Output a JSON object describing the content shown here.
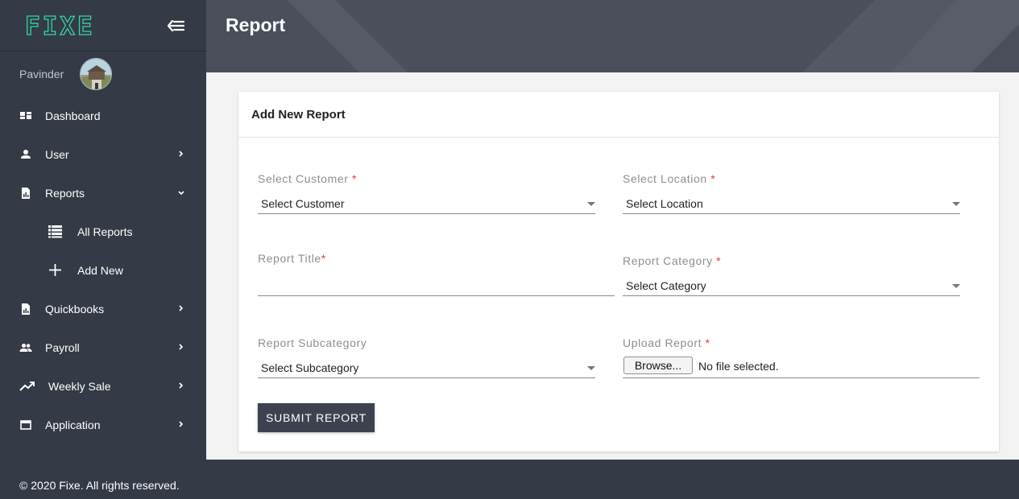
{
  "app": {
    "logo": "FIXE"
  },
  "user": {
    "name": "Pavinder"
  },
  "sidebar": {
    "items": [
      {
        "label": "Dashboard",
        "icon": "dashboard-icon"
      },
      {
        "label": "User",
        "icon": "person-icon"
      },
      {
        "label": "Reports",
        "icon": "report-icon"
      },
      {
        "label": "All Reports",
        "icon": "list-icon"
      },
      {
        "label": "Add New",
        "icon": "plus-icon"
      },
      {
        "label": "Quickbooks",
        "icon": "document-icon"
      },
      {
        "label": "Payroll",
        "icon": "people-icon"
      },
      {
        "label": "Weekly Sale",
        "icon": "trending-up-icon"
      },
      {
        "label": "Application",
        "icon": "window-icon"
      }
    ]
  },
  "header": {
    "title": "Report"
  },
  "form": {
    "title": "Add New Report",
    "customer": {
      "label": "Select Customer",
      "value": "Select Customer"
    },
    "location": {
      "label": "Select Location",
      "value": "Select Location"
    },
    "report_title": {
      "label": "Report Title",
      "value": ""
    },
    "category": {
      "label": "Report Category",
      "value": "Select Category"
    },
    "subcategory": {
      "label": "Report Subcategory",
      "value": "Select Subcategory"
    },
    "upload": {
      "label": "Upload Report",
      "button": "Browse...",
      "status": "No file selected."
    },
    "required_mark": "*",
    "submit_label": "SUBMIT REPORT"
  },
  "footer": {
    "text": "© 2020 Fixe. All rights reserved."
  },
  "colors": {
    "sidebar": "#343a46",
    "header": "#4a4f5b",
    "accent": "#33d6a0",
    "required": "#e53935",
    "button": "#3e4250"
  }
}
